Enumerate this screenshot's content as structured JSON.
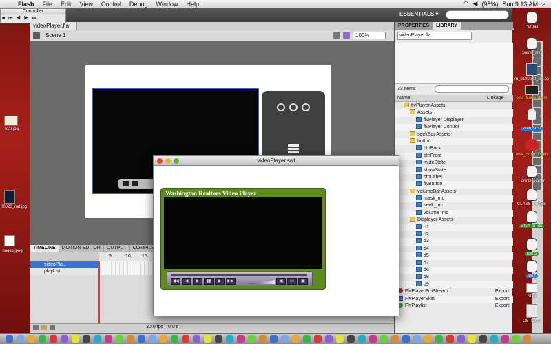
{
  "menubar": {
    "app": "Flash",
    "items": [
      "File",
      "Edit",
      "View",
      "Control",
      "Debug",
      "Window",
      "Help"
    ],
    "battery": "(98%)",
    "clock": "Sun 9:13 AM"
  },
  "controller": {
    "title": "Controller"
  },
  "flash": {
    "workspace": "ESSENTIALS ▾",
    "doc_tab": "videoPlayer.fla",
    "scene": "Scene 1",
    "zoom": "100%"
  },
  "timeline": {
    "tabs": [
      "TIMELINE",
      "MOTION EDITOR",
      "OUTPUT",
      "COMPILER ERRORS"
    ],
    "ticks": [
      "5",
      "10",
      "15"
    ],
    "layers": [
      "videoPla...",
      "playList"
    ],
    "fps": "30.0 fps",
    "time": "0.0 s"
  },
  "library": {
    "tabs": [
      "PROPERTIES",
      "LIBRARY"
    ],
    "document": "videoPlayer.fla",
    "count": "33 items",
    "col_name": "Name",
    "col_linkage": "Linkage",
    "items": [
      {
        "label": "flvPlayer Assets",
        "type": "folder",
        "indent": 1,
        "exp": ""
      },
      {
        "label": "Assets",
        "type": "folder",
        "indent": 2,
        "exp": ""
      },
      {
        "label": "flvPlayer Displayer",
        "type": "mc",
        "indent": 3,
        "exp": ""
      },
      {
        "label": "flvPlayer Control",
        "type": "mc",
        "indent": 3,
        "exp": ""
      },
      {
        "label": "seekBar Assets",
        "type": "folder",
        "indent": 2,
        "exp": ""
      },
      {
        "label": "button",
        "type": "folder",
        "indent": 2,
        "exp": ""
      },
      {
        "label": "btnBack",
        "type": "mc",
        "indent": 3,
        "exp": ""
      },
      {
        "label": "btnFront",
        "type": "mc",
        "indent": 3,
        "exp": ""
      },
      {
        "label": "muteState",
        "type": "mc",
        "indent": 3,
        "exp": ""
      },
      {
        "label": "showState",
        "type": "mc",
        "indent": 3,
        "exp": ""
      },
      {
        "label": "btnLabel",
        "type": "mc",
        "indent": 3,
        "exp": ""
      },
      {
        "label": "flvButton",
        "type": "mc",
        "indent": 3,
        "exp": ""
      },
      {
        "label": "volumeBar Assets",
        "type": "folder",
        "indent": 2,
        "exp": ""
      },
      {
        "label": "mask_mc",
        "type": "mc",
        "indent": 3,
        "exp": ""
      },
      {
        "label": "seek_mc",
        "type": "mc",
        "indent": 3,
        "exp": ""
      },
      {
        "label": "volume_mc",
        "type": "mc",
        "indent": 3,
        "exp": ""
      },
      {
        "label": "Displayer Assets",
        "type": "folder",
        "indent": 2,
        "exp": ""
      },
      {
        "label": "d1",
        "type": "mc",
        "indent": 3,
        "exp": ""
      },
      {
        "label": "d2",
        "type": "mc",
        "indent": 3,
        "exp": ""
      },
      {
        "label": "d3",
        "type": "mc",
        "indent": 3,
        "exp": ""
      },
      {
        "label": "d4",
        "type": "mc",
        "indent": 3,
        "exp": ""
      },
      {
        "label": "d5",
        "type": "mc",
        "indent": 3,
        "exp": ""
      },
      {
        "label": "d7",
        "type": "mc",
        "indent": 3,
        "exp": ""
      },
      {
        "label": "d6",
        "type": "mc",
        "indent": 3,
        "exp": ""
      },
      {
        "label": "d8",
        "type": "mc",
        "indent": 3,
        "exp": ""
      },
      {
        "label": "d9",
        "type": "mc",
        "indent": 3,
        "exp": ""
      },
      {
        "label": "FlvPlayerProStream",
        "type": "comp",
        "indent": 0,
        "exp": "Export:"
      },
      {
        "label": "FlvPlayerSkin",
        "type": "mc",
        "indent": 0,
        "exp": "Export:"
      },
      {
        "label": "FlvPlaylist",
        "type": "green",
        "indent": 0,
        "exp": "Export:"
      }
    ]
  },
  "swf": {
    "title": "videoPlayer.swf",
    "player_title": "Washington Realtors Video Player"
  },
  "desktop": {
    "left": [
      "fear.jpg",
      "00020_md.jpg",
      "nages.jpeg"
    ],
    "right": [
      "Furball",
      "Some_shit",
      "m_31986kit_dw.ps",
      "oise_Song.idrum",
      "Web Stuff",
      "oise_Song_Drum",
      "FormDesigner",
      "CLASS_PATHS",
      "Stuff_to_do",
      "idiots",
      "stuff",
      "SOS",
      "OS_Store",
      "ol"
    ]
  }
}
